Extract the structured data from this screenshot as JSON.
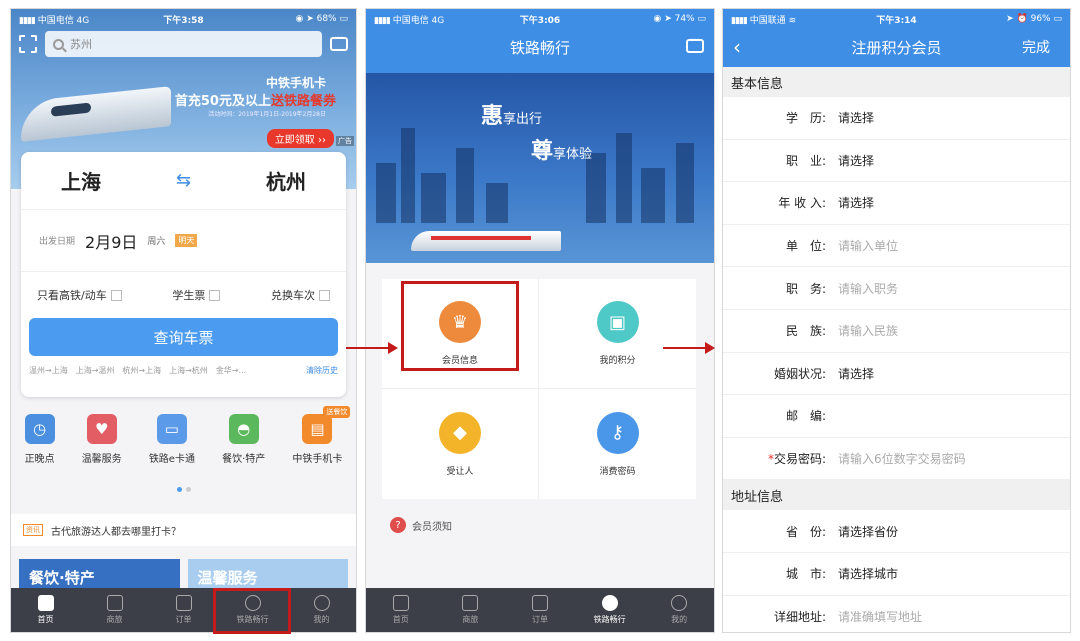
{
  "colors": {
    "accent": "#3f8ee6",
    "highlight": "#c41a1a",
    "tabbar": "#3c3f48"
  },
  "phone1": {
    "status": {
      "carrier": "中国电信  4G",
      "time": "下午3:58",
      "battery": "68%"
    },
    "search_placeholder": "苏州",
    "banner": {
      "title": "中铁手机卡",
      "sub_prefix": "首充50元及以上",
      "sub_highlight": "送铁路餐券",
      "date": "活动时间：2019年1月1日-2019年2月28日",
      "button": "立即领取 ››",
      "ad": "广告"
    },
    "from_city": "上海",
    "to_city": "杭州",
    "date_label": "出发日期",
    "date_value": "2月9日",
    "weekday": "周六",
    "today_tag": "明天",
    "options": [
      "只看高铁/动车",
      "学生票",
      "兑换车次"
    ],
    "query_button": "查询车票",
    "history": [
      "温州→上海",
      "上海→温州",
      "杭州→上海",
      "上海→杭州",
      "金华→..."
    ],
    "clear_history": "清除历史",
    "quick_items": [
      {
        "label": "正晚点",
        "icon": "clock-icon",
        "color": "#4a8fe0"
      },
      {
        "label": "温馨服务",
        "icon": "heart-icon",
        "color": "#e25d64"
      },
      {
        "label": "铁路e卡通",
        "icon": "card-icon",
        "color": "#5a9ae8"
      },
      {
        "label": "餐饮·特产",
        "icon": "cloche-icon",
        "color": "#5cb85c"
      },
      {
        "label": "中铁手机卡",
        "icon": "sim-icon",
        "color": "#f28a2c",
        "badge": "送餐饮"
      }
    ],
    "news_tag": "资讯",
    "news_text": "古代旅游达人都去哪里打卡？",
    "promo_a": "餐饮·特产",
    "promo_b": "温馨服务",
    "tabs": [
      "首页",
      "商旅",
      "订单",
      "铁路畅行",
      "我的"
    ]
  },
  "phone2": {
    "status": {
      "carrier": "中国电信  4G",
      "time": "下午3:06",
      "battery": "74%"
    },
    "title": "铁路畅行",
    "slogan1_big": "惠",
    "slogan1_rest": "享出行",
    "slogan2_big": "尊",
    "slogan2_rest": "享体验",
    "grid": [
      {
        "label": "会员信息",
        "icon": "crown-icon",
        "color": "#ee8a3c"
      },
      {
        "label": "我的积分",
        "icon": "gift-icon",
        "color": "#4fc8c8"
      },
      {
        "label": "受让人",
        "icon": "diamond-icon",
        "color": "#f3b42a"
      },
      {
        "label": "消费密码",
        "icon": "key-icon",
        "color": "#4a96e8"
      }
    ],
    "notice": "会员须知",
    "tabs": [
      "首页",
      "商旅",
      "订单",
      "铁路畅行",
      "我的"
    ]
  },
  "phone3": {
    "status": {
      "carrier": "中国联通",
      "time": "下午3:14",
      "battery": "96%"
    },
    "title": "注册积分会员",
    "done": "完成",
    "section_basic": "基本信息",
    "basic_rows": [
      {
        "label": "学　历:",
        "value": "请选择",
        "placeholder": false
      },
      {
        "label": "职　业:",
        "value": "请选择",
        "placeholder": false
      },
      {
        "label": "年 收 入:",
        "value": "请选择",
        "placeholder": false
      },
      {
        "label": "单　位:",
        "value": "请输入单位",
        "placeholder": true
      },
      {
        "label": "职　务:",
        "value": "请输入职务",
        "placeholder": true
      },
      {
        "label": "民　族:",
        "value": "请输入民族",
        "placeholder": true
      },
      {
        "label": "婚姻状况:",
        "value": "请选择",
        "placeholder": false
      },
      {
        "label": "邮　编:",
        "value": "",
        "placeholder": true
      },
      {
        "label": "交易密码:",
        "value": "请输入6位数字交易密码",
        "placeholder": true,
        "required": "*"
      }
    ],
    "section_address": "地址信息",
    "address_rows": [
      {
        "label": "省　份:",
        "value": "请选择省份",
        "placeholder": false
      },
      {
        "label": "城　市:",
        "value": "请选择城市",
        "placeholder": false
      },
      {
        "label": "详细地址:",
        "value": "请准确填写地址",
        "placeholder": true
      }
    ]
  }
}
